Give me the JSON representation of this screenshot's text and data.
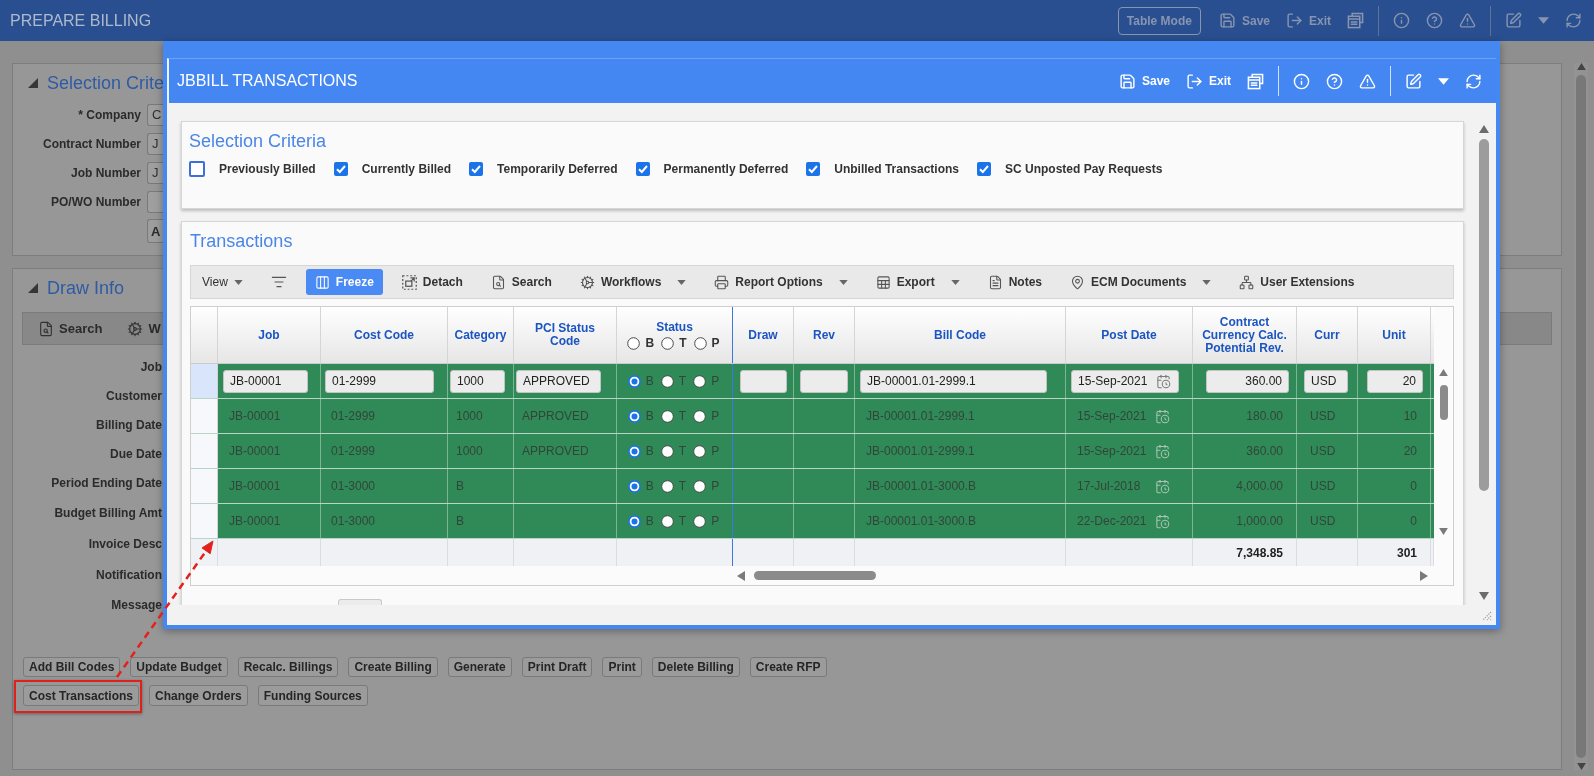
{
  "header": {
    "title": "PREPARE BILLING",
    "actions": [
      {
        "kind": "mode",
        "label": "Table Mode"
      },
      {
        "kind": "save",
        "label": "Save"
      },
      {
        "kind": "exit",
        "label": "Exit"
      },
      {
        "kind": "windows"
      },
      {
        "kind": "divider"
      },
      {
        "kind": "info"
      },
      {
        "kind": "help"
      },
      {
        "kind": "warning"
      },
      {
        "kind": "divider"
      },
      {
        "kind": "edit"
      },
      {
        "kind": "caret"
      },
      {
        "kind": "refresh"
      }
    ]
  },
  "selection_panel": {
    "title": "Selection Crite",
    "fields": [
      {
        "label": "* Company",
        "value": "C"
      },
      {
        "label": "Contract Number",
        "value": "J"
      },
      {
        "label": "Job Number",
        "value": "J"
      },
      {
        "label": "PO/WO Number"
      }
    ],
    "button": "A"
  },
  "draw_info": {
    "title": "Draw Info",
    "toolbar": [
      {
        "kind": "search",
        "label": "Search"
      },
      {
        "kind": "workflows",
        "label": "W"
      }
    ],
    "fields": [
      "Job",
      "Customer",
      "Billing Date",
      "Due Date",
      "Period Ending Date",
      "Budget Billing Amt",
      "Invoice Desc",
      "Notification",
      "Message"
    ],
    "buttons": [
      [
        {
          "label": "Add Bill Codes",
          "highlighted": false
        },
        {
          "label": "Update Budget",
          "highlighted": false
        },
        {
          "label": "Recalc. Billings",
          "highlighted": false
        },
        {
          "label": "Create Billing",
          "highlighted": false
        },
        {
          "label": "Generate",
          "highlighted": false
        },
        {
          "label": "Print Draft",
          "highlighted": false
        },
        {
          "label": "Print",
          "highlighted": false
        },
        {
          "label": "Delete Billing",
          "highlighted": false
        },
        {
          "label": "Create RFP",
          "highlighted": false
        }
      ],
      [
        {
          "label": "Cost Transactions",
          "highlighted": true
        },
        {
          "label": "Change Orders",
          "highlighted": false
        },
        {
          "label": "Funding Sources",
          "highlighted": false
        }
      ]
    ]
  },
  "dialog": {
    "title": "JBBILL TRANSACTIONS",
    "actions": [
      {
        "kind": "save",
        "label": "Save"
      },
      {
        "kind": "exit",
        "label": "Exit"
      },
      {
        "kind": "windows"
      },
      {
        "kind": "divider"
      },
      {
        "kind": "info"
      },
      {
        "kind": "help"
      },
      {
        "kind": "warning"
      },
      {
        "kind": "divider"
      },
      {
        "kind": "edit"
      },
      {
        "kind": "caret"
      },
      {
        "kind": "refresh"
      }
    ],
    "selection_criteria": {
      "title": "Selection Criteria",
      "options": [
        {
          "label": "Previously Billed",
          "checked": false
        },
        {
          "label": "Currently Billed",
          "checked": true
        },
        {
          "label": "Temporarily Deferred",
          "checked": true
        },
        {
          "label": "Permanently Deferred",
          "checked": true
        },
        {
          "label": "Unbilled Transactions",
          "checked": true
        },
        {
          "label": "SC Unposted Pay Requests",
          "checked": true
        }
      ]
    },
    "transactions": {
      "title": "Transactions",
      "toolbar": [
        {
          "kind": "view",
          "label": "View",
          "dropdown": true,
          "active": false
        },
        {
          "kind": "filter",
          "active": false
        },
        {
          "kind": "freeze",
          "label": "Freeze",
          "active": true
        },
        {
          "kind": "detach",
          "label": "Detach",
          "active": false
        },
        {
          "kind": "search",
          "label": "Search",
          "active": false
        },
        {
          "kind": "workflows",
          "label": "Workflows",
          "dropdown": true,
          "active": false
        },
        {
          "kind": "print",
          "label": "Report Options",
          "dropdown": true,
          "active": false
        },
        {
          "kind": "export",
          "label": "Export",
          "dropdown": true,
          "active": false
        },
        {
          "kind": "notes",
          "label": "Notes",
          "active": false
        },
        {
          "kind": "documents",
          "label": "ECM Documents",
          "dropdown": true,
          "active": false
        },
        {
          "kind": "hierarchy",
          "label": "User Extensions",
          "active": false
        }
      ],
      "table": {
        "columns": [
          "Job",
          "Cost Code",
          "Category",
          "PCI Status Code",
          "Status",
          "Draw",
          "Rev",
          "Bill Code",
          "Post Date",
          "Contract Currency Calc. Potential Rev.",
          "Curr",
          "Unit"
        ],
        "status_filter": [
          {
            "label": "B",
            "selected": false
          },
          {
            "label": "T",
            "selected": false
          },
          {
            "label": "P",
            "selected": false
          }
        ],
        "rows": [
          {
            "selected": true,
            "editing": true,
            "job": "JB-00001",
            "cost_code": "01-2999",
            "category": "1000",
            "pci_status_code": "APPROVED",
            "status": [
              {
                "label": "B",
                "selected": true
              },
              {
                "label": "T",
                "selected": false
              },
              {
                "label": "P",
                "selected": false
              }
            ],
            "bill_code": "JB-00001.01-2999.1",
            "post_date": "15-Sep-2021",
            "contract_currency_calc_potential_rev": "360.00",
            "curr": "USD",
            "unit": "20"
          },
          {
            "selected": false,
            "editing": false,
            "job": "JB-00001",
            "cost_code": "01-2999",
            "category": "1000",
            "pci_status_code": "APPROVED",
            "status": [
              {
                "label": "B",
                "selected": true
              },
              {
                "label": "T",
                "selected": false
              },
              {
                "label": "P",
                "selected": false
              }
            ],
            "bill_code": "JB-00001.01-2999.1",
            "post_date": "15-Sep-2021",
            "contract_currency_calc_potential_rev": "180.00",
            "curr": "USD",
            "unit": "10"
          },
          {
            "selected": false,
            "editing": false,
            "job": "JB-00001",
            "cost_code": "01-2999",
            "category": "1000",
            "pci_status_code": "APPROVED",
            "status": [
              {
                "label": "B",
                "selected": true
              },
              {
                "label": "T",
                "selected": false
              },
              {
                "label": "P",
                "selected": false
              }
            ],
            "bill_code": "JB-00001.01-2999.1",
            "post_date": "15-Sep-2021",
            "contract_currency_calc_potential_rev": "360.00",
            "curr": "USD",
            "unit": "20"
          },
          {
            "selected": false,
            "editing": false,
            "job": "JB-00001",
            "cost_code": "01-3000",
            "category": "B",
            "status": [
              {
                "label": "B",
                "selected": true
              },
              {
                "label": "T",
                "selected": false
              },
              {
                "label": "P",
                "selected": false
              }
            ],
            "bill_code": "JB-00001.01-3000.B",
            "post_date": "17-Jul-2018",
            "contract_currency_calc_potential_rev": "4,000.00",
            "curr": "USD",
            "unit": "0"
          },
          {
            "selected": false,
            "editing": false,
            "job": "JB-00001",
            "cost_code": "01-3000",
            "category": "B",
            "status": [
              {
                "label": "B",
                "selected": true
              },
              {
                "label": "T",
                "selected": false
              },
              {
                "label": "P",
                "selected": false
              }
            ],
            "bill_code": "JB-00001.01-3000.B",
            "post_date": "22-Dec-2021",
            "contract_currency_calc_potential_rev": "1,000.00",
            "curr": "USD",
            "unit": "0"
          }
        ],
        "totals": {
          "contract_currency_calc_potential_rev": "7,348.85",
          "unit": "301"
        }
      }
    }
  }
}
